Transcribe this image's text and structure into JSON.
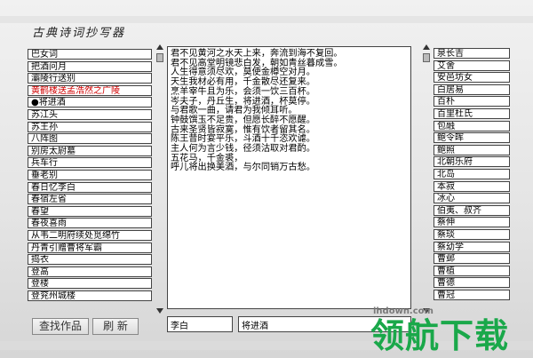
{
  "app": {
    "title": "古典诗词抄写器"
  },
  "left_list": [
    {
      "label": "巴女词"
    },
    {
      "label": "把酒问月"
    },
    {
      "label": "灞陵行送别"
    },
    {
      "label": "黄鹤楼送孟浩然之广陵",
      "highlight": true
    },
    {
      "label": "●将进酒"
    },
    {
      "label": "苏江头"
    },
    {
      "label": "苏王孙"
    },
    {
      "label": "八阵图"
    },
    {
      "label": "别房太尉墓"
    },
    {
      "label": "兵车行"
    },
    {
      "label": "垂老别"
    },
    {
      "label": "春日忆李白"
    },
    {
      "label": "春宿左省"
    },
    {
      "label": "春望"
    },
    {
      "label": "春夜喜雨"
    },
    {
      "label": "从韦二明府续处觅绵竹"
    },
    {
      "label": "丹青引赠曹将军霸"
    },
    {
      "label": "捣衣"
    },
    {
      "label": "登高"
    },
    {
      "label": "登楼"
    },
    {
      "label": "登兖州城楼"
    }
  ],
  "right_list": [
    {
      "label": "泉长吉"
    },
    {
      "label": "艾舍"
    },
    {
      "label": "安邑坊女"
    },
    {
      "label": "白居易"
    },
    {
      "label": "百朴"
    },
    {
      "label": "百里杜氏"
    },
    {
      "label": "包融"
    },
    {
      "label": "鲍令晖"
    },
    {
      "label": "鲍照"
    },
    {
      "label": "北朝乐府"
    },
    {
      "label": "北岛"
    },
    {
      "label": "本寂"
    },
    {
      "label": "冰心"
    },
    {
      "label": "伯夷、叔齐"
    },
    {
      "label": "蔡伸"
    },
    {
      "label": "蔡琰"
    },
    {
      "label": "蔡幼学"
    },
    {
      "label": "曹邺"
    },
    {
      "label": "曹植"
    },
    {
      "label": "曹德"
    },
    {
      "label": "曹冠"
    }
  ],
  "poem": {
    "lines": [
      "君不见黄河之水天上来，奔流到海不复回。",
      "君不见高堂明镜悲白发，朝如青丝暮成雪。",
      "人生得意须尽欢，莫使金樽空对月。",
      "天生我材必有用，千金散尽还复来。",
      "烹羊宰牛且为乐，会须一饮三百杯。",
      "岑夫子，丹丘生，将进酒，杯莫停。",
      "与君歌一曲，请君为我倾耳听。",
      "钟鼓馔玉不足贵，但愿长醉不愿醒。",
      "古来圣贤皆寂寞，惟有饮者留其名。",
      "陈王昔时宴平乐，斗酒十千恣欢谑。",
      "主人何为言少钱，径须沽取对君酌。",
      "五花马，千金裘，",
      "呼儿将出换美酒，与尔同销万古愁。"
    ]
  },
  "fields": {
    "author": "李白",
    "title": "将进酒"
  },
  "buttons": {
    "search": "查找作品",
    "print": "刷 新"
  },
  "watermark": {
    "big": "领航下载",
    "small": "lhdown.com"
  }
}
